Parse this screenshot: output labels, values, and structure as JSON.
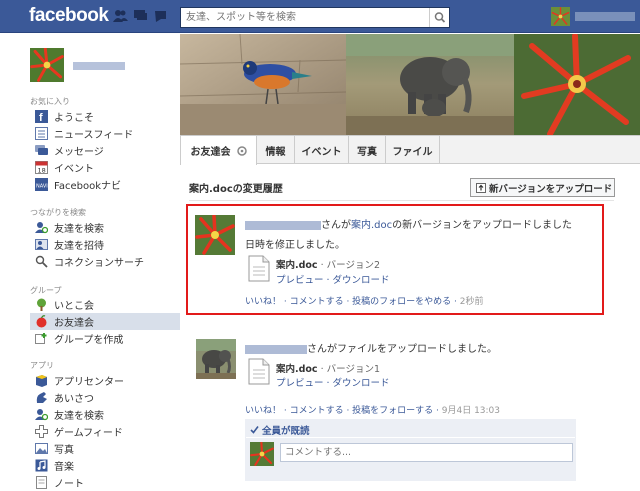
{
  "topbar": {
    "logo": "facebook",
    "search_placeholder": "友達、スポット等を検索",
    "colors": {
      "bar": "#3b5998"
    }
  },
  "sidebar": {
    "favorites_heading": "お気に入り",
    "favorites": [
      {
        "label": "ようこそ",
        "icon": "facebook-f-icon"
      },
      {
        "label": "ニュースフィード",
        "icon": "news-feed-icon"
      },
      {
        "label": "メッセージ",
        "icon": "messages-icon"
      },
      {
        "label": "イベント",
        "icon": "calendar-icon"
      },
      {
        "label": "Facebookナビ",
        "icon": "navi-icon"
      }
    ],
    "connect_heading": "つながりを検索",
    "connect": [
      {
        "label": "友達を検索",
        "icon": "find-friends-icon"
      },
      {
        "label": "友達を招待",
        "icon": "invite-friends-icon"
      },
      {
        "label": "コネクションサーチ",
        "icon": "magnifier-icon"
      }
    ],
    "groups_heading": "グループ",
    "groups": [
      {
        "label": "いとこ会",
        "icon": "tree-icon"
      },
      {
        "label": "お友達会",
        "icon": "apple-icon",
        "selected": true
      },
      {
        "label": "グループを作成",
        "icon": "create-group-icon"
      }
    ],
    "apps_heading": "アプリ",
    "apps": [
      {
        "label": "アプリセンター",
        "icon": "app-center-icon"
      },
      {
        "label": "あいさつ",
        "icon": "greeting-icon"
      },
      {
        "label": "友達を検索",
        "icon": "find-friends-icon"
      },
      {
        "label": "ゲームフィード",
        "icon": "game-feed-icon"
      },
      {
        "label": "写真",
        "icon": "photos-icon"
      },
      {
        "label": "音楽",
        "icon": "music-icon"
      },
      {
        "label": "ノート",
        "icon": "notes-icon"
      }
    ]
  },
  "tabs": [
    {
      "label": "お友達会",
      "active": true
    },
    {
      "label": "情報"
    },
    {
      "label": "イベント"
    },
    {
      "label": "写真"
    },
    {
      "label": "ファイル"
    }
  ],
  "main": {
    "heading": "案内.docの変更履歴",
    "upload_button": "新バージョンをアップロード"
  },
  "post1": {
    "text_suffix": "さんが",
    "doc_link": "案内.doc",
    "text_rest": "の新バージョンをアップロードしました",
    "message": "日時を修正しました。",
    "doc_title": "案内.doc",
    "doc_version": " · バージョン2",
    "doc_links": "プレビュー · ダウンロード",
    "actions": "いいね！ · コメントする · 投稿のフォローをやめる · ",
    "time": "2秒前"
  },
  "post2": {
    "text": "さんがファイルをアップロードしました。",
    "doc_title": "案内.doc",
    "doc_version": " · バージョン1",
    "doc_links": "プレビュー · ダウンロード",
    "actions": "いいね！ · コメントする · 投稿をフォローする · ",
    "time": "9月4日 13:03",
    "seen": "全員が既読",
    "comment_placeholder": "コメントする..."
  }
}
